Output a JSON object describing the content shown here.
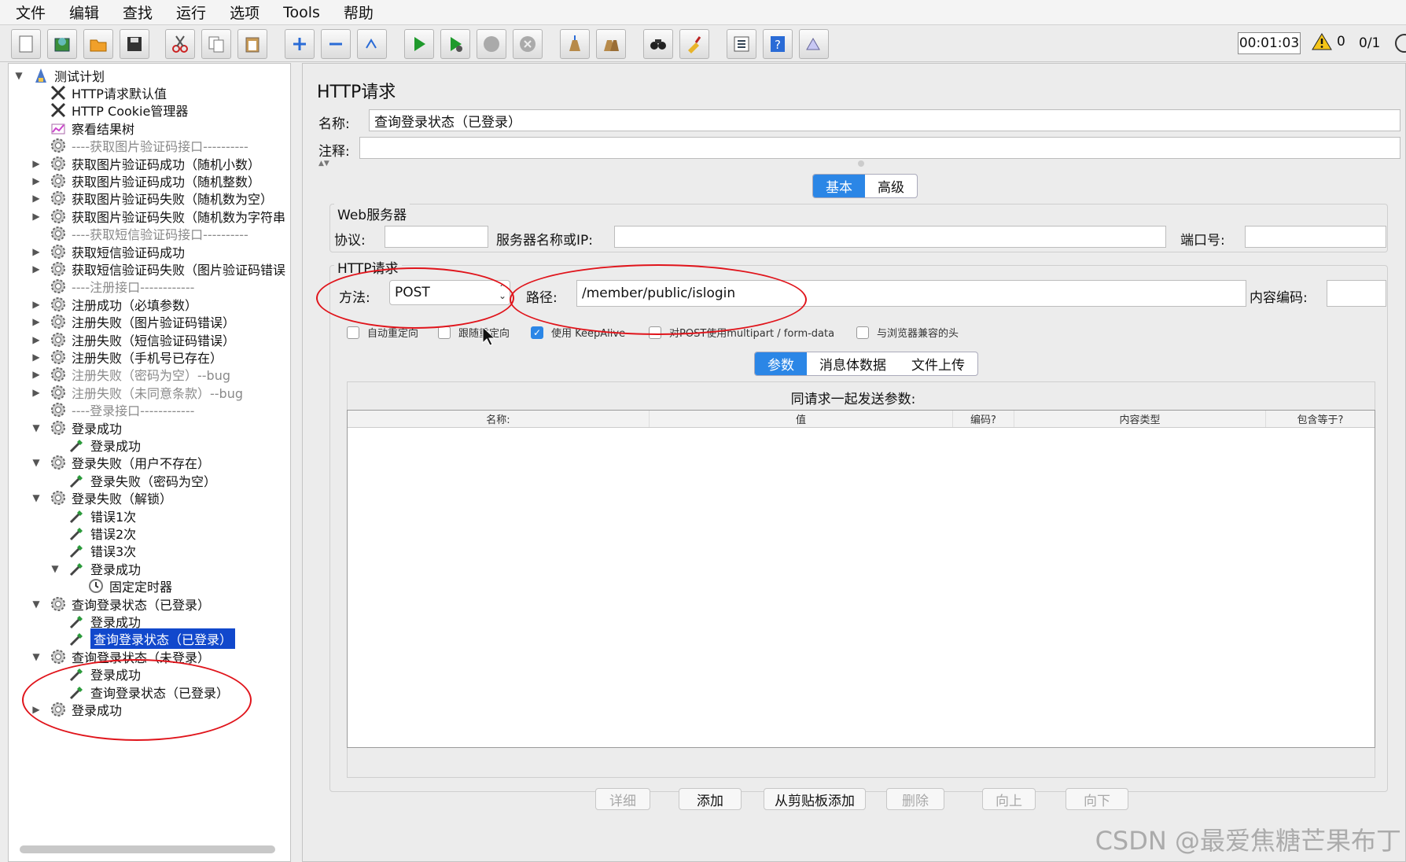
{
  "menubar": {
    "items": [
      "文件",
      "编辑",
      "查找",
      "运行",
      "选项",
      "Tools",
      "帮助"
    ]
  },
  "toolbar": {
    "buttons": [
      "new-icon",
      "templates-icon",
      "open-icon",
      "save-icon",
      "cut-icon",
      "copy-icon",
      "paste-icon",
      "expand-icon",
      "collapse-icon",
      "toggle-icon",
      "start-icon",
      "start-no-pause-icon",
      "stop-icon",
      "shutdown-icon",
      "clear-icon",
      "clear-all-icon",
      "search-icon",
      "reset-search-icon",
      "function-helper-icon",
      "help-icon",
      "remote-icon"
    ],
    "timer": "00:01:03",
    "warning_count": "0",
    "thread_counts": "0/1"
  },
  "tree": {
    "items": [
      {
        "label": "测试计划",
        "icon": "test-plan-icon",
        "arrow": "▼"
      },
      {
        "label": "HTTP请求默认值",
        "icon": "config-wrench-icon",
        "arrow": ""
      },
      {
        "label": "HTTP Cookie管理器",
        "icon": "config-wrench-icon",
        "arrow": ""
      },
      {
        "label": "察看结果树",
        "icon": "listener-chart-icon",
        "arrow": ""
      },
      {
        "label": "----获取图片验证码接口----------",
        "icon": "thread-group-gear-icon",
        "arrow": "",
        "dim": true
      },
      {
        "label": "获取图片验证码成功（随机小数）",
        "icon": "thread-group-gear-icon",
        "arrow": "▶"
      },
      {
        "label": "获取图片验证码成功（随机整数）",
        "icon": "thread-group-gear-icon",
        "arrow": "▶"
      },
      {
        "label": "获取图片验证码失败（随机数为空）",
        "icon": "thread-group-gear-icon",
        "arrow": "▶"
      },
      {
        "label": "获取图片验证码失败（随机数为字符串",
        "icon": "thread-group-gear-icon",
        "arrow": "▶"
      },
      {
        "label": "----获取短信验证码接口----------",
        "icon": "thread-group-gear-icon",
        "arrow": "",
        "dim": true
      },
      {
        "label": "获取短信验证码成功",
        "icon": "thread-group-gear-icon",
        "arrow": "▶"
      },
      {
        "label": "获取短信验证码失败（图片验证码错误",
        "icon": "thread-group-gear-icon",
        "arrow": "▶"
      },
      {
        "label": "----注册接口------------",
        "icon": "thread-group-gear-icon",
        "arrow": "",
        "dim": true
      },
      {
        "label": "注册成功（必填参数）",
        "icon": "thread-group-gear-icon",
        "arrow": "▶"
      },
      {
        "label": "注册失败（图片验证码错误）",
        "icon": "thread-group-gear-icon",
        "arrow": "▶"
      },
      {
        "label": "注册失败（短信验证码错误）",
        "icon": "thread-group-gear-icon",
        "arrow": "▶"
      },
      {
        "label": "注册失败（手机号已存在）",
        "icon": "thread-group-gear-icon",
        "arrow": "▶"
      },
      {
        "label": "注册失败（密码为空）--bug",
        "icon": "thread-group-gear-icon",
        "arrow": "▶",
        "dim": true
      },
      {
        "label": "注册失败（未同意条款）--bug",
        "icon": "thread-group-gear-icon",
        "arrow": "▶",
        "dim": true
      },
      {
        "label": "----登录接口------------",
        "icon": "thread-group-gear-icon",
        "arrow": "",
        "dim": true
      },
      {
        "label": "登录成功",
        "icon": "thread-group-gear-icon",
        "arrow": "▼"
      },
      {
        "label": "登录成功",
        "icon": "sampler-pipette-icon",
        "arrow": "",
        "indent": 1
      },
      {
        "label": "登录失败（用户不存在）",
        "icon": "thread-group-gear-icon",
        "arrow": "▼"
      },
      {
        "label": "登录失败（密码为空）",
        "icon": "sampler-pipette-icon",
        "arrow": "",
        "indent": 1
      },
      {
        "label": "登录失败（解锁）",
        "icon": "thread-group-gear-icon",
        "arrow": "▼"
      },
      {
        "label": "错误1次",
        "icon": "sampler-pipette-icon",
        "arrow": "",
        "indent": 1
      },
      {
        "label": "错误2次",
        "icon": "sampler-pipette-icon",
        "arrow": "",
        "indent": 1
      },
      {
        "label": "错误3次",
        "icon": "sampler-pipette-icon",
        "arrow": "",
        "indent": 1
      },
      {
        "label": "登录成功",
        "icon": "sampler-pipette-icon",
        "arrow": "▼",
        "indent": 1
      },
      {
        "label": "固定定时器",
        "icon": "timer-clock-icon",
        "arrow": "",
        "indent": 2
      },
      {
        "label": "查询登录状态（已登录）",
        "icon": "thread-group-gear-icon",
        "arrow": "▼"
      },
      {
        "label": "登录成功",
        "icon": "sampler-pipette-icon",
        "arrow": "",
        "indent": 1
      },
      {
        "label": "查询登录状态（已登录）",
        "icon": "sampler-pipette-icon",
        "arrow": "",
        "indent": 1,
        "selected": true
      },
      {
        "label": "查询登录状态（未登录）",
        "icon": "thread-group-gear-icon",
        "arrow": "▼"
      },
      {
        "label": "登录成功",
        "icon": "sampler-pipette-icon",
        "arrow": "",
        "indent": 1
      },
      {
        "label": "查询登录状态（已登录）",
        "icon": "sampler-pipette-icon",
        "arrow": "",
        "indent": 1
      },
      {
        "label": "登录成功",
        "icon": "thread-group-gear-icon",
        "arrow": "▶"
      }
    ]
  },
  "form": {
    "title": "HTTP请求",
    "name_label": "名称:",
    "name_value": "查询登录状态（已登录）",
    "comment_label": "注释:",
    "comment_value": "",
    "tabs": [
      "基本",
      "高级"
    ],
    "web_server": {
      "title": "Web服务器",
      "protocol_label": "协议:",
      "protocol_value": "",
      "server_label": "服务器名称或IP:",
      "server_value": "",
      "port_label": "端口号:",
      "port_value": ""
    },
    "http_request": {
      "title": "HTTP请求",
      "method_label": "方法:",
      "method_value": "POST",
      "path_label": "路径:",
      "path_value": "/member/public/islogin",
      "encoding_label": "内容编码:",
      "encoding_value": ""
    },
    "checkboxes": [
      {
        "label": "自动重定向",
        "checked": false
      },
      {
        "label": "跟随重定向",
        "checked": false
      },
      {
        "label": "使用 KeepAlive",
        "checked": true
      },
      {
        "label": "对POST使用multipart / form-data",
        "checked": false
      },
      {
        "label": "与浏览器兼容的头",
        "checked": false
      }
    ],
    "sub_tabs": [
      "参数",
      "消息体数据",
      "文件上传"
    ],
    "params_caption": "同请求一起发送参数:",
    "table_headers": [
      "名称:",
      "值",
      "编码?",
      "内容类型",
      "包含等于?"
    ],
    "buttons": [
      {
        "label": "详细",
        "enabled": false
      },
      {
        "label": "添加",
        "enabled": true
      },
      {
        "label": "从剪贴板添加",
        "enabled": true
      },
      {
        "label": "删除",
        "enabled": false
      },
      {
        "label": "向上",
        "enabled": false
      },
      {
        "label": "向下",
        "enabled": false
      }
    ]
  },
  "colors": {
    "accent": "#2b86e6",
    "selection": "#1148cc",
    "annotation": "#e0141b"
  },
  "watermark": "CSDN @最爱焦糖芒果布丁"
}
